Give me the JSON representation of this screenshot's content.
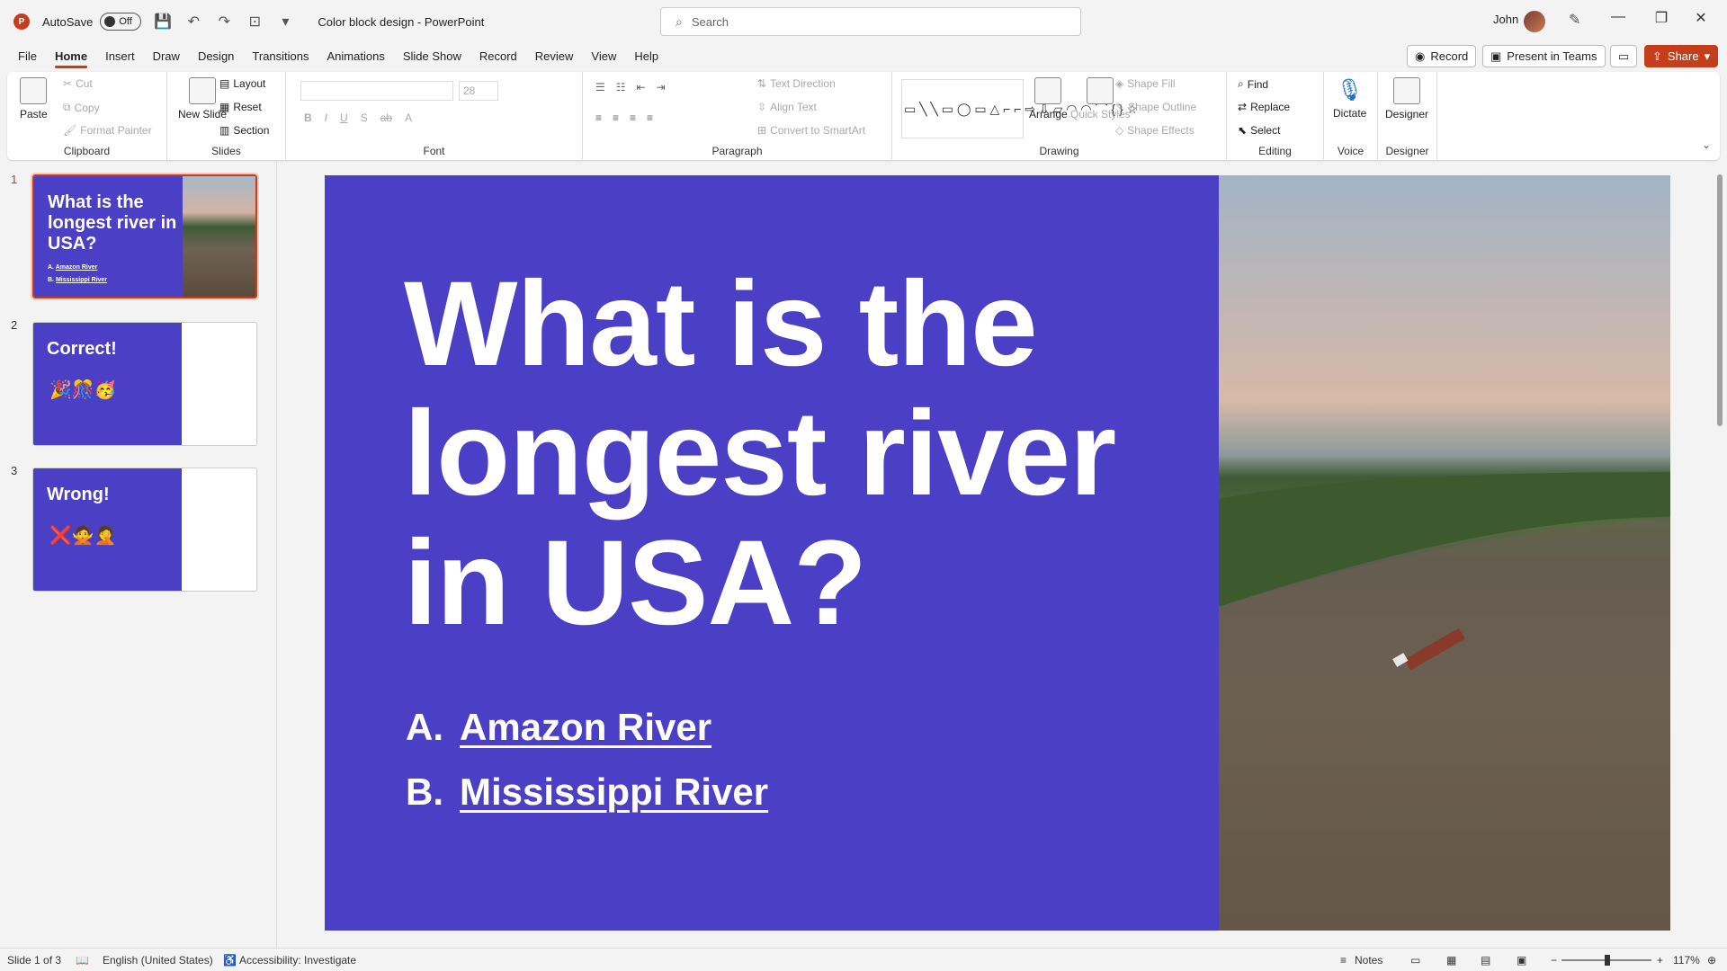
{
  "app": {
    "logo_letter": "P",
    "autosave_label": "AutoSave",
    "autosave_state": "Off",
    "doc_title": "Color block design - PowerPoint",
    "search_placeholder": "Search",
    "user_name": "John"
  },
  "tabs": [
    "File",
    "Home",
    "Insert",
    "Draw",
    "Design",
    "Transitions",
    "Animations",
    "Slide Show",
    "Record",
    "Review",
    "View",
    "Help"
  ],
  "active_tab": "Home",
  "menu_right": {
    "record": "Record",
    "present_teams": "Present in Teams",
    "share": "Share"
  },
  "ribbon": {
    "clipboard": {
      "paste": "Paste",
      "cut": "Cut",
      "copy": "Copy",
      "format_painter": "Format Painter",
      "label": "Clipboard"
    },
    "slides": {
      "new_slide": "New Slide",
      "layout": "Layout",
      "reset": "Reset",
      "section": "Section",
      "label": "Slides"
    },
    "font": {
      "label": "Font",
      "size": "28"
    },
    "paragraph": {
      "text_direction": "Text Direction",
      "align_text": "Align Text",
      "convert_smartart": "Convert to SmartArt",
      "label": "Paragraph"
    },
    "drawing": {
      "arrange": "Arrange",
      "quick_styles": "Quick Styles",
      "shape_fill": "Shape Fill",
      "shape_outline": "Shape Outline",
      "shape_effects": "Shape Effects",
      "label": "Drawing"
    },
    "editing": {
      "find": "Find",
      "replace": "Replace",
      "select": "Select",
      "label": "Editing"
    },
    "voice": {
      "dictate": "Dictate",
      "label": "Voice"
    },
    "designer": {
      "designer": "Designer",
      "label": "Designer"
    }
  },
  "thumbnails": [
    {
      "num": "1",
      "title": "What is the longest river in USA?",
      "opt_a": "A.",
      "ans_a": "Amazon River",
      "opt_b": "B.",
      "ans_b": "Mississippi River"
    },
    {
      "num": "2",
      "title": "Correct!",
      "emojis": "🎉🎊🥳"
    },
    {
      "num": "3",
      "title": "Wrong!",
      "emojis": "❌🙅🤦"
    }
  ],
  "slide": {
    "title": "What is the longest river in USA?",
    "option_a_letter": "A.",
    "option_a": "Amazon River",
    "option_b_letter": "B.",
    "option_b": "Mississippi River"
  },
  "status": {
    "slide_count": "Slide 1 of 3",
    "language": "English (United States)",
    "accessibility": "Accessibility: Investigate",
    "notes": "Notes",
    "zoom": "117%"
  },
  "colors": {
    "accent": "#c43e1c",
    "slide_block": "#4b3fc6"
  }
}
